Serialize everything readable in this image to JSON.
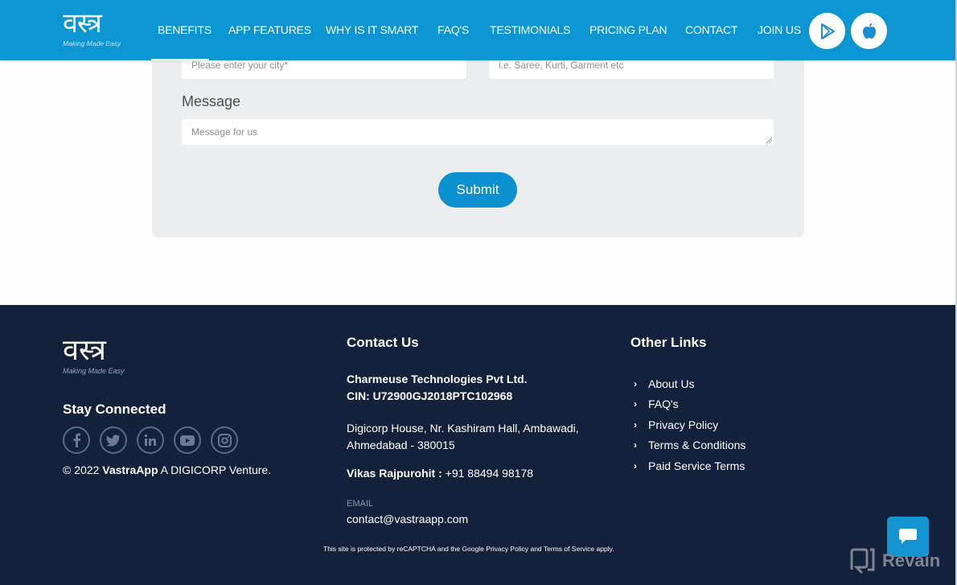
{
  "header": {
    "logo": {
      "mark": "वस्त्र",
      "tagline": "Making Made Easy"
    },
    "nav": [
      {
        "label": "BENEFITS",
        "active": true
      },
      {
        "label": "APP FEATURES"
      },
      {
        "label": "WHY IS IT SMART"
      },
      {
        "label": "FAQ'S"
      },
      {
        "label": "TESTIMONIALS"
      },
      {
        "label": "PRICING PLAN"
      },
      {
        "label": "CONTACT"
      },
      {
        "label": "JOIN US"
      }
    ],
    "store_buttons": [
      {
        "icon": "google-play-icon"
      },
      {
        "icon": "apple-icon"
      }
    ]
  },
  "form": {
    "city_placeholder": "Please enter your city*",
    "product_placeholder": "i.e. Saree, Kurti, Garment etc",
    "message_label": "Message",
    "message_placeholder": "Message for us",
    "submit_label": "Submit"
  },
  "footer": {
    "logo": {
      "mark": "वस्त्र",
      "tagline": "Making Made Easy"
    },
    "stay_connected": "Stay Connected",
    "socials": [
      "facebook",
      "twitter",
      "linkedin",
      "youtube",
      "instagram"
    ],
    "copyright_prefix": "© 2022 ",
    "copyright_brand": "VastraApp",
    "copyright_suffix": " A DIGICORP Venture.",
    "contact": {
      "heading": "Contact Us",
      "company": "Charmeuse Technologies Pvt Ltd.",
      "cin": "CIN: U72900GJ2018PTC102968",
      "address_line1": "Digicorp House, Nr. Kashiram Hall, Ambawadi,",
      "address_line2": "Ahmedabad - 380015",
      "person": "Vikas Rajpurohit :",
      "phone": " +91 88494 98178",
      "email_label": "EMAIL",
      "email": "contact@vastraapp.com"
    },
    "other_links": {
      "heading": "Other Links",
      "items": [
        "About Us",
        "FAQ's",
        "Privacy Policy",
        "Terms & Conditions",
        "Paid Service Terms"
      ]
    },
    "recaptcha_notice": "This site is protected by reCAPTCHA and the Google Privacy Policy and Terms of Service apply."
  },
  "widgets": {
    "revain_label": "Revain"
  },
  "colors": {
    "header_bg": "#0b95d3",
    "footer_bg": "#13213a",
    "panel_bg": "#ecedef",
    "accent": "#0b91d0"
  }
}
